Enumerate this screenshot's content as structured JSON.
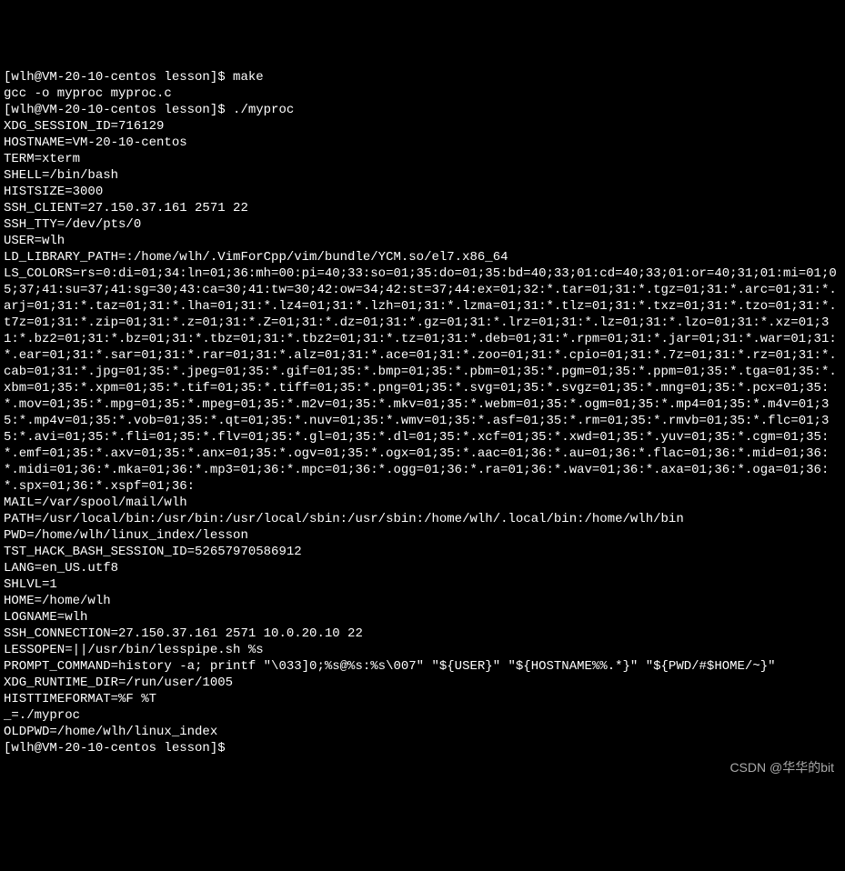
{
  "terminal": {
    "lines": [
      "[wlh@VM-20-10-centos lesson]$ make",
      "gcc -o myproc myproc.c",
      "[wlh@VM-20-10-centos lesson]$ ./myproc",
      "XDG_SESSION_ID=716129",
      "HOSTNAME=VM-20-10-centos",
      "TERM=xterm",
      "SHELL=/bin/bash",
      "HISTSIZE=3000",
      "SSH_CLIENT=27.150.37.161 2571 22",
      "SSH_TTY=/dev/pts/0",
      "USER=wlh",
      "LD_LIBRARY_PATH=:/home/wlh/.VimForCpp/vim/bundle/YCM.so/el7.x86_64",
      "LS_COLORS=rs=0:di=01;34:ln=01;36:mh=00:pi=40;33:so=01;35:do=01;35:bd=40;33;01:cd=40;33;01:or=40;31;01:mi=01;05;37;41:su=37;41:sg=30;43:ca=30;41:tw=30;42:ow=34;42:st=37;44:ex=01;32:*.tar=01;31:*.tgz=01;31:*.arc=01;31:*.arj=01;31:*.taz=01;31:*.lha=01;31:*.lz4=01;31:*.lzh=01;31:*.lzma=01;31:*.tlz=01;31:*.txz=01;31:*.tzo=01;31:*.t7z=01;31:*.zip=01;31:*.z=01;31:*.Z=01;31:*.dz=01;31:*.gz=01;31:*.lrz=01;31:*.lz=01;31:*.lzo=01;31:*.xz=01;31:*.bz2=01;31:*.bz=01;31:*.tbz=01;31:*.tbz2=01;31:*.tz=01;31:*.deb=01;31:*.rpm=01;31:*.jar=01;31:*.war=01;31:*.ear=01;31:*.sar=01;31:*.rar=01;31:*.alz=01;31:*.ace=01;31:*.zoo=01;31:*.cpio=01;31:*.7z=01;31:*.rz=01;31:*.cab=01;31:*.jpg=01;35:*.jpeg=01;35:*.gif=01;35:*.bmp=01;35:*.pbm=01;35:*.pgm=01;35:*.ppm=01;35:*.tga=01;35:*.xbm=01;35:*.xpm=01;35:*.tif=01;35:*.tiff=01;35:*.png=01;35:*.svg=01;35:*.svgz=01;35:*.mng=01;35:*.pcx=01;35:*.mov=01;35:*.mpg=01;35:*.mpeg=01;35:*.m2v=01;35:*.mkv=01;35:*.webm=01;35:*.ogm=01;35:*.mp4=01;35:*.m4v=01;35:*.mp4v=01;35:*.vob=01;35:*.qt=01;35:*.nuv=01;35:*.wmv=01;35:*.asf=01;35:*.rm=01;35:*.rmvb=01;35:*.flc=01;35:*.avi=01;35:*.fli=01;35:*.flv=01;35:*.gl=01;35:*.dl=01;35:*.xcf=01;35:*.xwd=01;35:*.yuv=01;35:*.cgm=01;35:*.emf=01;35:*.axv=01;35:*.anx=01;35:*.ogv=01;35:*.ogx=01;35:*.aac=01;36:*.au=01;36:*.flac=01;36:*.mid=01;36:*.midi=01;36:*.mka=01;36:*.mp3=01;36:*.mpc=01;36:*.ogg=01;36:*.ra=01;36:*.wav=01;36:*.axa=01;36:*.oga=01;36:*.spx=01;36:*.xspf=01;36:",
      "MAIL=/var/spool/mail/wlh",
      "PATH=/usr/local/bin:/usr/bin:/usr/local/sbin:/usr/sbin:/home/wlh/.local/bin:/home/wlh/bin",
      "PWD=/home/wlh/linux_index/lesson",
      "TST_HACK_BASH_SESSION_ID=52657970586912",
      "LANG=en_US.utf8",
      "SHLVL=1",
      "HOME=/home/wlh",
      "LOGNAME=wlh",
      "SSH_CONNECTION=27.150.37.161 2571 10.0.20.10 22",
      "LESSOPEN=||/usr/bin/lesspipe.sh %s",
      "PROMPT_COMMAND=history -a; printf \"\\033]0;%s@%s:%s\\007\" \"${USER}\" \"${HOSTNAME%%.*}\" \"${PWD/#$HOME/~}\"",
      "XDG_RUNTIME_DIR=/run/user/1005",
      "HISTTIMEFORMAT=%F %T",
      "_=./myproc",
      "OLDPWD=/home/wlh/linux_index",
      "[wlh@VM-20-10-centos lesson]$"
    ]
  },
  "watermark": "CSDN @华华的bit"
}
